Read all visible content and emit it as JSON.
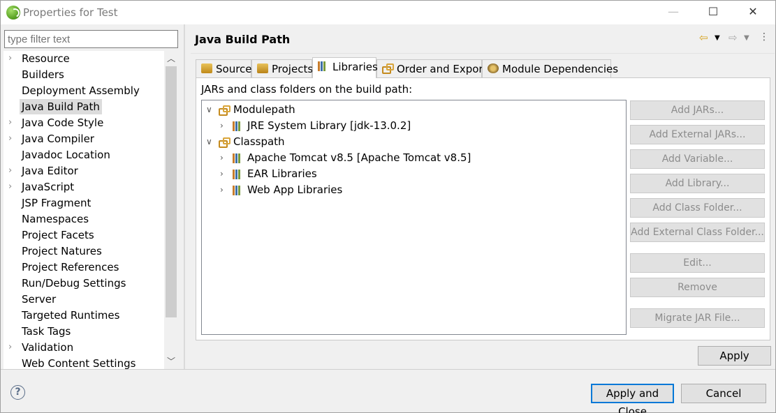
{
  "window": {
    "title": "Properties for Test"
  },
  "filter": {
    "placeholder": "type filter text"
  },
  "categories": [
    {
      "label": "Resource",
      "expandable": true
    },
    {
      "label": "Builders",
      "expandable": false
    },
    {
      "label": "Deployment Assembly",
      "expandable": false
    },
    {
      "label": "Java Build Path",
      "expandable": false,
      "selected": true
    },
    {
      "label": "Java Code Style",
      "expandable": true
    },
    {
      "label": "Java Compiler",
      "expandable": true
    },
    {
      "label": "Javadoc Location",
      "expandable": false
    },
    {
      "label": "Java Editor",
      "expandable": true
    },
    {
      "label": "JavaScript",
      "expandable": true
    },
    {
      "label": "JSP Fragment",
      "expandable": false
    },
    {
      "label": "Namespaces",
      "expandable": false
    },
    {
      "label": "Project Facets",
      "expandable": false
    },
    {
      "label": "Project Natures",
      "expandable": false
    },
    {
      "label": "Project References",
      "expandable": false
    },
    {
      "label": "Run/Debug Settings",
      "expandable": false
    },
    {
      "label": "Server",
      "expandable": false
    },
    {
      "label": "Targeted Runtimes",
      "expandable": false
    },
    {
      "label": "Task Tags",
      "expandable": false
    },
    {
      "label": "Validation",
      "expandable": true
    },
    {
      "label": "Web Content Settings",
      "expandable": false
    }
  ],
  "page": {
    "title": "Java Build Path"
  },
  "tabs": [
    {
      "label": "Source",
      "icon": "source-folder-icon"
    },
    {
      "label": "Projects",
      "icon": "projects-folder-icon"
    },
    {
      "label": "Libraries",
      "icon": "libraries-icon",
      "active": true
    },
    {
      "label": "Order and Export",
      "icon": "order-export-icon"
    },
    {
      "label": "Module Dependencies",
      "icon": "module-dependencies-icon"
    }
  ],
  "libraries": {
    "label": "JARs and class folders on the build path:",
    "tree": {
      "modulepath": "Modulepath",
      "jre": "JRE System Library [jdk-13.0.2]",
      "classpath": "Classpath",
      "tomcat": "Apache Tomcat v8.5 [Apache Tomcat v8.5]",
      "ear": "EAR Libraries",
      "webapp": "Web App Libraries"
    },
    "buttons": {
      "add_jars": "Add JARs...",
      "add_external_jars": "Add External JARs...",
      "add_variable": "Add Variable...",
      "add_library": "Add Library...",
      "add_class_folder": "Add Class Folder...",
      "add_external_class_folder": "Add External Class Folder...",
      "edit": "Edit...",
      "remove": "Remove",
      "migrate": "Migrate JAR File..."
    }
  },
  "footer": {
    "apply": "Apply",
    "apply_and_close": "Apply and Close",
    "cancel": "Cancel",
    "help": "?"
  },
  "colors": {
    "focus_border": "#0078d7",
    "selected_bg": "#dcdcdc",
    "disabled_text": "#8c8c8c"
  }
}
